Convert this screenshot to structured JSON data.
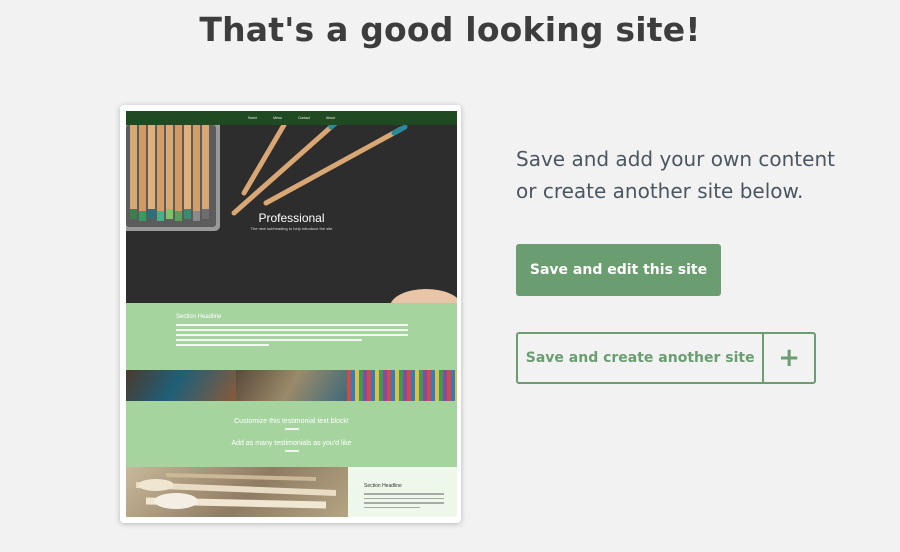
{
  "headline": "That's a good looking site!",
  "preview": {
    "nav_items": [
      "Home",
      "Menu",
      "Contact",
      "About"
    ],
    "hero_title": "Professional",
    "hero_subtitle": "The new subheading to help introduce the site",
    "section1_title": "Section Headline",
    "testimonial_title": "Customize this testimonial text block!",
    "testimonial_sub": "Add as many testimonials as you'd like",
    "bottom_title": "Section Headline"
  },
  "lead_text": "Save and add your own content or create another site below.",
  "actions": {
    "save_edit_label": "Save and edit this site",
    "save_create_label": "Save and create another site",
    "plus_label": "+"
  },
  "colors": {
    "accent": "#6a9e70",
    "preview_green": "#a5d49e",
    "nav_dark": "#1f4a22"
  }
}
